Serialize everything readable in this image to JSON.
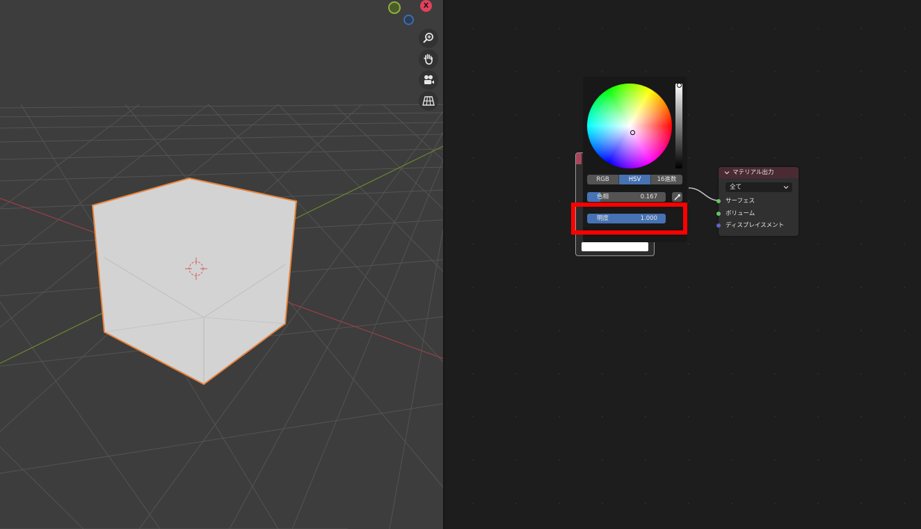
{
  "gizmo": {
    "x_label": "X"
  },
  "viewport_nav": {
    "zoom_icon": "zoom-icon",
    "pan_icon": "hand-icon",
    "camera_icon": "camera-icon",
    "ortho_icon": "grid-icon"
  },
  "color_picker": {
    "modes": [
      "RGB",
      "HSV",
      "16進数"
    ],
    "active_mode": "HSV",
    "hue": {
      "label": "色相",
      "value": "0.167",
      "fraction": 0.167
    },
    "value": {
      "label": "明度",
      "value": "1.000",
      "fraction": 1.0
    },
    "eyedropper_icon": "eyedropper-icon"
  },
  "material_output": {
    "title": "マテリアル出力",
    "target": "全て",
    "sockets": [
      "サーフェス",
      "ボリューム",
      "ディスプレイスメント"
    ]
  },
  "colors": {
    "accent": "#4772b3",
    "highlight": "#ff0000",
    "selection_outline": "#e8833a",
    "socket_shader": "#63c763",
    "socket_vector": "#6363c7"
  }
}
